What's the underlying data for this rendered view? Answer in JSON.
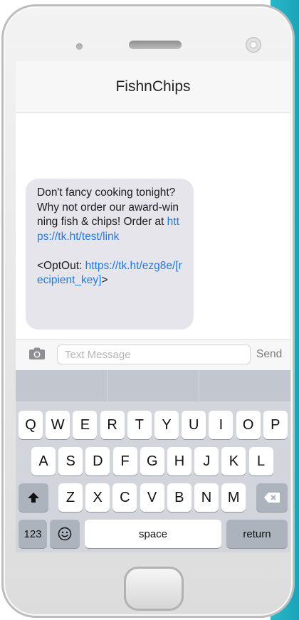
{
  "conversation": {
    "contact_name": "FishnChips"
  },
  "message": {
    "text_1": "Don't fancy cooking tonight? Why not order our award-winning fish & chips! Order at ",
    "link_1": "https://tk.ht/test/link",
    "text_2": "\n\n<OptOut: ",
    "link_2": "https://tk.ht/ezg8e/[recipient_key]",
    "text_3": ">"
  },
  "composer": {
    "placeholder": "Text Message",
    "send_label": "Send"
  },
  "keyboard": {
    "row1": [
      "Q",
      "W",
      "E",
      "R",
      "T",
      "Y",
      "U",
      "I",
      "O",
      "P"
    ],
    "row2": [
      "A",
      "S",
      "D",
      "F",
      "G",
      "H",
      "J",
      "K",
      "L"
    ],
    "row3": [
      "Z",
      "X",
      "C",
      "V",
      "B",
      "N",
      "M"
    ],
    "numbers_label": "123",
    "space_label": "space",
    "return_label": "return"
  },
  "colors": {
    "link": "#1f7ae0",
    "bubble": "#e6e5eb",
    "accent_teal": "#2ab8c8"
  }
}
